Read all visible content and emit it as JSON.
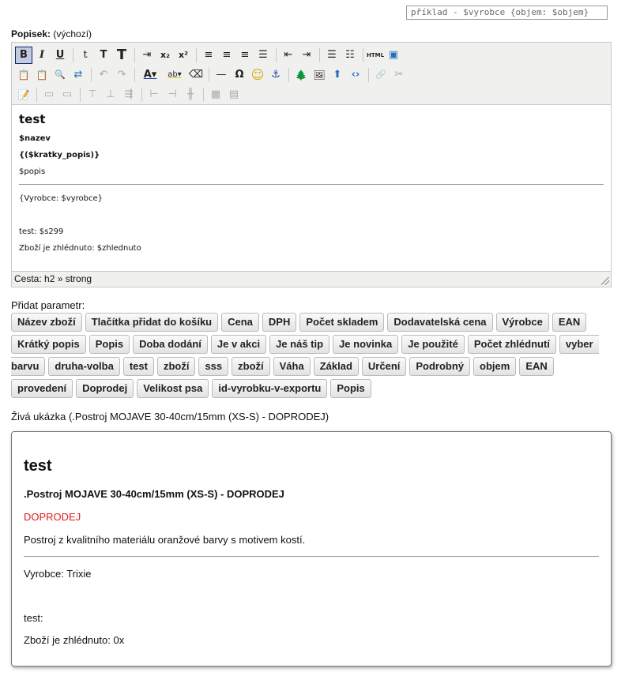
{
  "example": "příklad - $vyrobce {objem: $objem}",
  "field": {
    "label": "Popisek:",
    "note": "(výchozí)"
  },
  "toolbar": {
    "row1": [
      {
        "name": "bold-button",
        "glyph": "B",
        "style": "font-weight:bold;",
        "state": "active"
      },
      {
        "name": "italic-button",
        "glyph": "I",
        "style": "font-style:italic;font-family:'DejaVu Serif',serif;font-weight:bold;"
      },
      {
        "name": "underline-button",
        "glyph": "U",
        "style": "text-decoration:underline;font-weight:bold;"
      },
      {
        "sep": true
      },
      {
        "name": "small-text-button",
        "glyph": "t",
        "style": "font-family:'DejaVu Serif',serif;"
      },
      {
        "name": "medium-text-button",
        "glyph": "T",
        "style": "font-weight:bold;"
      },
      {
        "name": "large-text-button",
        "glyph": "T",
        "style": "font-weight:bold;font-size:18px;"
      },
      {
        "sep": true
      },
      {
        "name": "indent-format-icon",
        "glyph": "⇥"
      },
      {
        "name": "subscript-button",
        "glyph": "x₂",
        "style": "font-size:11px;font-weight:bold;"
      },
      {
        "name": "superscript-button",
        "glyph": "x²",
        "style": "font-size:11px;font-weight:bold;"
      },
      {
        "sep": true
      },
      {
        "name": "align-left-button",
        "glyph": "≡"
      },
      {
        "name": "align-center-button",
        "glyph": "≡"
      },
      {
        "name": "align-right-button",
        "glyph": "≡"
      },
      {
        "name": "align-justify-button",
        "glyph": "☰"
      },
      {
        "sep": true
      },
      {
        "name": "outdent-button",
        "glyph": "⇤"
      },
      {
        "name": "indent-button",
        "glyph": "⇥"
      },
      {
        "sep": true
      },
      {
        "name": "bullet-list-button",
        "glyph": "☰"
      },
      {
        "name": "numbered-list-button",
        "glyph": "☷"
      },
      {
        "sep": true
      },
      {
        "name": "html-source-button",
        "glyph": "HTML",
        "style": "font-size:7px;font-weight:bold;"
      },
      {
        "name": "preview-button",
        "glyph": "▣",
        "style": "color:#2a6cc0;"
      }
    ],
    "row2": [
      {
        "name": "paste-text-button",
        "glyph": "📋",
        "style": "font-size:12px;"
      },
      {
        "name": "paste-word-button",
        "glyph": "📋",
        "style": "font-size:12px;"
      },
      {
        "name": "find-button",
        "glyph": "🔍",
        "style": "font-size:11px;"
      },
      {
        "name": "replace-button",
        "glyph": "⇄",
        "style": "color:#2a6cc0;"
      },
      {
        "sep": true
      },
      {
        "name": "undo-button",
        "glyph": "↶",
        "state": "disabled"
      },
      {
        "name": "redo-button",
        "glyph": "↷",
        "state": "disabled"
      },
      {
        "sep": true
      },
      {
        "name": "text-color-button",
        "glyph": "A▾",
        "style": "text-decoration:underline;text-decoration-color:#1a3fa0;font-weight:bold;width:30px;"
      },
      {
        "name": "highlight-color-button",
        "glyph": "ab▾",
        "style": "font-size:10px;text-decoration:underline;text-decoration-color:#e6c200;width:30px;"
      },
      {
        "name": "clear-format-button",
        "glyph": "⌫"
      },
      {
        "sep": true
      },
      {
        "name": "horizontal-rule-button",
        "glyph": "—"
      },
      {
        "name": "special-char-button",
        "glyph": "Ω",
        "style": "font-weight:bold;"
      },
      {
        "name": "emoticon-button",
        "glyph": "☺",
        "style": "color:#d4a800;font-size:16px;"
      },
      {
        "name": "anchor-button",
        "glyph": "⚓",
        "style": "color:#1a3fa0;"
      },
      {
        "sep": true
      },
      {
        "name": "image-button",
        "glyph": "🌲",
        "style": "font-size:12px;"
      },
      {
        "name": "image-manager-button",
        "glyph": "🖼",
        "style": "font-size:12px;"
      },
      {
        "name": "upload-button",
        "glyph": "⬆",
        "style": "color:#2a6cc0;"
      },
      {
        "name": "embed-button",
        "glyph": "‹›",
        "style": "color:#2a6cc0;font-weight:bold;"
      },
      {
        "sep": true
      },
      {
        "name": "link-button",
        "glyph": "🔗",
        "state": "disabled",
        "style": "font-size:11px;"
      },
      {
        "name": "unlink-button",
        "glyph": "✂",
        "state": "disabled"
      }
    ],
    "row3": [
      {
        "name": "edit-css-button",
        "glyph": "📝",
        "style": "font-size:12px;"
      },
      {
        "sep": true
      },
      {
        "name": "table-row-props-button",
        "glyph": "▭",
        "state": "disabled"
      },
      {
        "name": "table-cell-props-button",
        "glyph": "▭",
        "state": "disabled"
      },
      {
        "sep": true
      },
      {
        "name": "insert-row-before-button",
        "glyph": "⊤",
        "state": "disabled"
      },
      {
        "name": "insert-row-after-button",
        "glyph": "⊥",
        "state": "disabled"
      },
      {
        "name": "delete-row-button",
        "glyph": "⇶",
        "state": "disabled"
      },
      {
        "sep": true
      },
      {
        "name": "insert-col-before-button",
        "glyph": "⊢",
        "state": "disabled"
      },
      {
        "name": "insert-col-after-button",
        "glyph": "⊣",
        "state": "disabled"
      },
      {
        "name": "delete-col-button",
        "glyph": "╫",
        "state": "disabled"
      },
      {
        "sep": true
      },
      {
        "name": "split-cells-button",
        "glyph": "▦",
        "state": "disabled"
      },
      {
        "name": "merge-cells-button",
        "glyph": "▤",
        "state": "disabled"
      }
    ]
  },
  "editor": {
    "h2": "test",
    "nazev": "$nazev",
    "kratky": "{($kratky_popis)}",
    "popis": "$popis",
    "vyrobce": "{Vyrobce: $vyrobce}",
    "test": "test: $s299",
    "zhlednuto": "Zboží je zhlédnuto: $zhlednuto"
  },
  "status": "Cesta: h2 » strong",
  "add_param_label": "Přidat parametr:",
  "param_rows": [
    [
      "Název zboží",
      "Tlačítka přidat do košíku",
      "Cena",
      "DPH",
      "Počet skladem",
      "Dodavatelská cena",
      "Výrobce",
      "EAN"
    ],
    [
      "Krátký popis",
      "Popis",
      "Doba dodání",
      "Je v akci",
      "Je náš tip",
      "Je novinka",
      "Je použité",
      "Počet zhlédnutí",
      "vyber"
    ],
    [
      "barvu",
      "druha-volba",
      "test",
      "zboží",
      "sss",
      "zboží",
      "Váha",
      "Základ",
      "Určení",
      "Podrobný",
      "objem",
      "EAN"
    ],
    [
      "provedení",
      "Doprodej",
      "Velikost psa",
      "id-vyrobku-v-exportu",
      "Popis"
    ]
  ],
  "live_label": "Živá ukázka (.Postroj MOJAVE 30-40cm/15mm (XS-S) - DOPRODEJ)",
  "preview": {
    "h2": "test",
    "nazev": ".Postroj MOJAVE 30-40cm/15mm (XS-S) - DOPRODEJ",
    "kratky": "DOPRODEJ",
    "popis": "Postroj z kvalitního materiálu oranžové barvy s motivem kostí.",
    "vyrobce": "Vyrobce: Trixie",
    "test": "test:",
    "zhlednuto": "Zboží je zhlédnuto: 0x"
  },
  "colors": {
    "accent_red": "#e21b1b",
    "toolbar_bg": "#f0f0ee"
  }
}
